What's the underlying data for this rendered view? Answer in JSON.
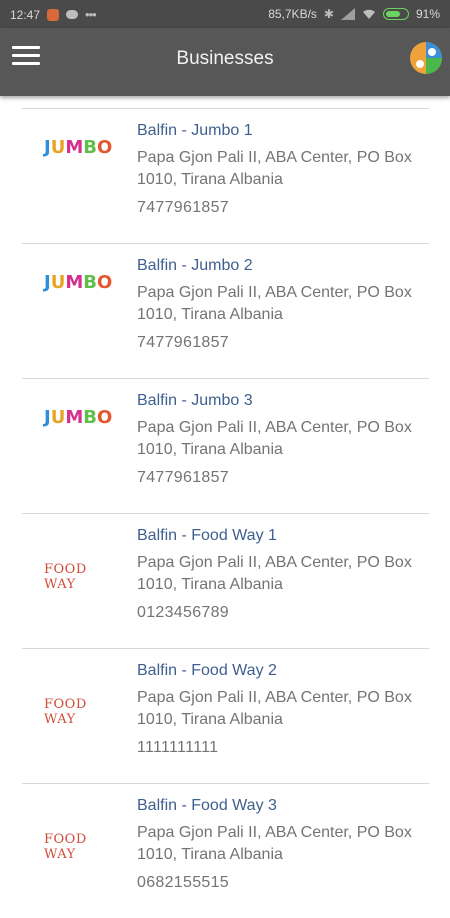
{
  "status_bar": {
    "time": "12:47",
    "network_speed": "85,7KB/s",
    "battery_percent": "91%",
    "battery_level": 0.91
  },
  "app_bar": {
    "title": "Businesses",
    "menu_icon": "hamburger-menu-icon",
    "logo_icon": "app-logo-icon"
  },
  "businesses": [
    {
      "name": "Balfin - Jumbo 1",
      "address": "Papa Gjon Pali II, ABA Center, PO Box 1010, Tirana Albania",
      "phone": "7477961857",
      "logo_text": "JUMBO",
      "logo": "jumbo"
    },
    {
      "name": "Balfin - Jumbo 2",
      "address": "Papa Gjon Pali II, ABA Center, PO Box 1010, Tirana Albania",
      "phone": "7477961857",
      "logo_text": "JUMBO",
      "logo": "jumbo"
    },
    {
      "name": "Balfin - Jumbo 3",
      "address": "Papa Gjon Pali II, ABA Center, PO Box 1010, Tirana Albania",
      "phone": "7477961857",
      "logo_text": "JUMBO",
      "logo": "jumbo"
    },
    {
      "name": "Balfin - Food Way 1",
      "address": "Papa Gjon Pali II, ABA Center, PO Box 1010, Tirana Albania",
      "phone": "0123456789",
      "logo_text": "FOOD WAY",
      "logo": "foodway"
    },
    {
      "name": "Balfin - Food Way 2",
      "address": "Papa Gjon Pali II, ABA Center, PO Box 1010, Tirana Albania",
      "phone": "1111111111",
      "logo_text": "FOOD WAY",
      "logo": "foodway"
    },
    {
      "name": "Balfin - Food Way 3",
      "address": "Papa Gjon Pali II, ABA Center, PO Box 1010, Tirana Albania",
      "phone": "0682155515",
      "logo_text": "FOOD WAY",
      "logo": "foodway"
    }
  ],
  "colors": {
    "app_bar": "#575757",
    "status_bar": "#4a4a4a",
    "name_text": "#3f5f8f",
    "detail_text": "#747474",
    "divider": "#d9d9d9",
    "foodway_logo": "#d24b3a"
  }
}
